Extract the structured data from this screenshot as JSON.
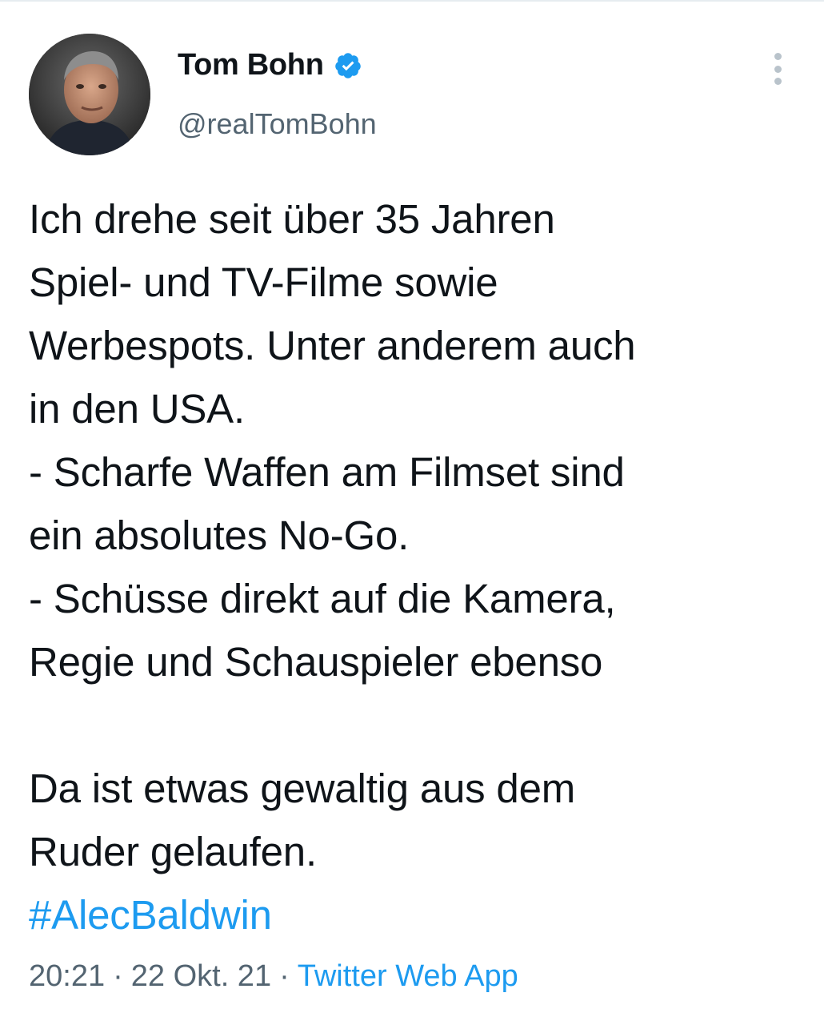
{
  "author": {
    "display_name": "Tom Bohn",
    "handle": "@realTomBohn",
    "verified": true,
    "avatar_icon": "profile-photo"
  },
  "tweet": {
    "lines": [
      "Ich drehe seit über 35 Jahren",
      "Spiel- und TV-Filme sowie",
      "Werbespots. Unter anderem auch",
      "in den USA.",
      "- Scharfe Waffen am Filmset sind",
      "ein absolutes No-Go.",
      "- Schüsse direkt auf die Kamera,",
      "Regie und Schauspieler ebenso",
      "",
      "Da ist etwas gewaltig aus dem",
      "Ruder gelaufen."
    ],
    "hashtag": "#AlecBaldwin"
  },
  "meta": {
    "time": "20:21",
    "separator": "·",
    "date": "22 Okt. 21",
    "source": "Twitter Web App"
  },
  "colors": {
    "text": "#0f1419",
    "secondary": "#536471",
    "accent": "#1d9bf0"
  }
}
